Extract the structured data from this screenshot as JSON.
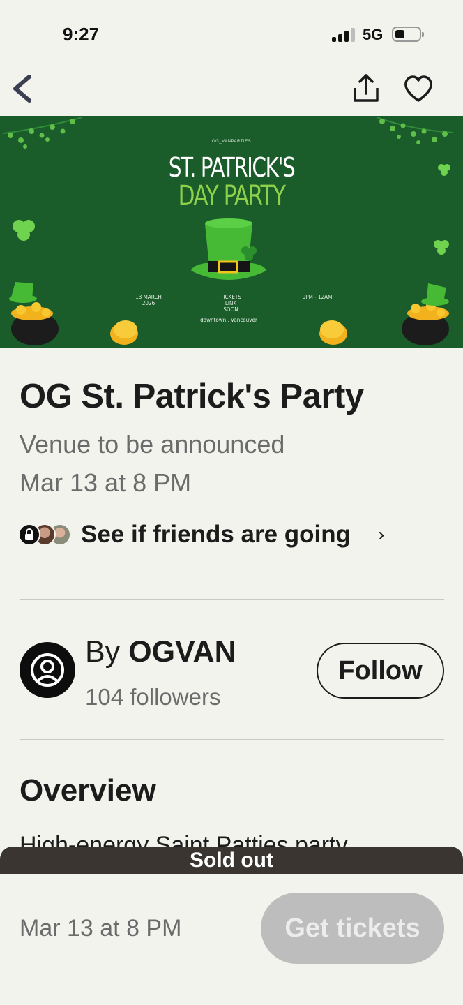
{
  "status_bar": {
    "time": "9:27",
    "network": "5G"
  },
  "nav": {
    "back_icon": "chevron-left-icon",
    "share_icon": "share-icon",
    "like_icon": "heart-icon"
  },
  "banner": {
    "tag": "OG_VANPARTIES",
    "title_line1": "ST. PATRICK'S",
    "title_line2": "DAY PARTY",
    "date_line1": "13 MARCH",
    "date_line2": "2026",
    "tickets_line1": "TICKETS",
    "tickets_line2": "LINK",
    "tickets_line3": "SOON",
    "time_range": "9PM - 12AM",
    "location": "downtown , Vancouver",
    "colors": {
      "background": "#1a5c2a",
      "accent": "#8ed04a",
      "gold": "#f2b21d"
    }
  },
  "event": {
    "title": "OG St. Patrick's Party",
    "venue": "Venue to be announced",
    "datetime": "Mar 13 at 8 PM"
  },
  "friends": {
    "label": "See if friends are going",
    "chevron": "›"
  },
  "organizer": {
    "by_prefix": "By",
    "name": "OGVAN",
    "followers": "104 followers",
    "follow_label": "Follow"
  },
  "overview": {
    "title": "Overview",
    "preview": "High-energy Saint Patties party"
  },
  "bottom": {
    "status": "Sold out",
    "date": "Mar 13 at 8 PM",
    "cta": "Get tickets"
  }
}
